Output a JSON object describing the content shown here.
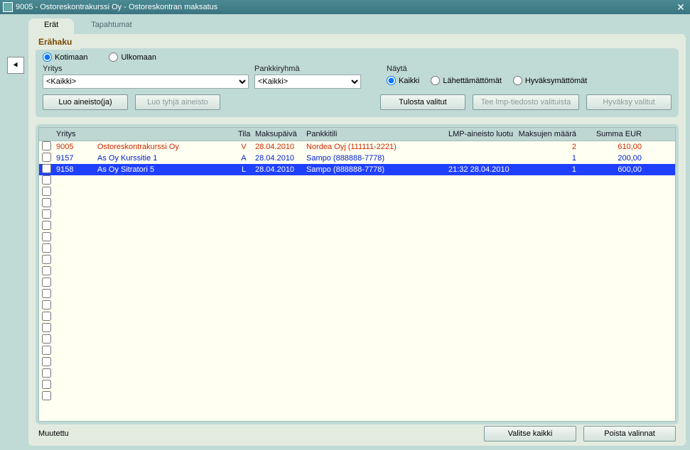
{
  "window": {
    "title": "9005 - Ostoreskontrakurssi Oy - Ostoreskontran maksatus"
  },
  "tabs": {
    "erat": "Erät",
    "tapahtumat": "Tapahtumat"
  },
  "search": {
    "title": "Erähaku",
    "radio_kotimaan": "Kotimaan",
    "radio_ulkomaan": "Ulkomaan",
    "yritys_label": "Yritys",
    "yritys_value": "<Kaikki>",
    "pankkiryhma_label": "Pankkiryhmä",
    "pankkiryhma_value": "<Kaikki>",
    "nayta_label": "Näytä",
    "nayta_kaikki": "Kaikki",
    "nayta_laheta": "Lähettämättömät",
    "nayta_hyvaksy": "Hyväksymättömät"
  },
  "buttons": {
    "luo_aineisto": "Luo aineisto(ja)",
    "luo_tyhja": "Luo tyhjä aineisto",
    "tulosta": "Tulosta valitut",
    "tee_lmp": "Tee lmp-tiedosto valituista",
    "hyvaksy": "Hyväksy valitut",
    "valitse_kaikki": "Valitse kaikki",
    "poista_valinnat": "Poista valinnat"
  },
  "columns": {
    "yritys": "Yritys",
    "tila": "Tila",
    "maksupaiva": "Maksupäivä",
    "pankkitili": "Pankkitili",
    "lmp": "LMP-aineisto luotu",
    "maksujen": "Maksujen määrä",
    "summa": "Summa EUR"
  },
  "rows": [
    {
      "yritys": "9005",
      "name": "Ostoreskontrakurssi Oy",
      "tila": "V",
      "maksupaiva": "28.04.2010",
      "pankkitili": "Nordea Oyj (111111-2221)",
      "lmp": "",
      "maksujen": "2",
      "summa": "610,00",
      "selected": false
    },
    {
      "yritys": "9157",
      "name": "As Oy Kurssitie 1",
      "tila": "A",
      "maksupaiva": "28.04.2010",
      "pankkitili": "Sampo (888888-7778)",
      "lmp": "",
      "maksujen": "1",
      "summa": "200,00",
      "selected": false
    },
    {
      "yritys": "9158",
      "name": "As Oy Sitratori 5",
      "tila": "L",
      "maksupaiva": "28.04.2010",
      "pankkitili": "Sampo (888888-7778)",
      "lmp": "21:32 28.04.2010",
      "maksujen": "1",
      "summa": "600,00",
      "selected": true
    }
  ],
  "status": {
    "muutettu": "Muutettu"
  }
}
